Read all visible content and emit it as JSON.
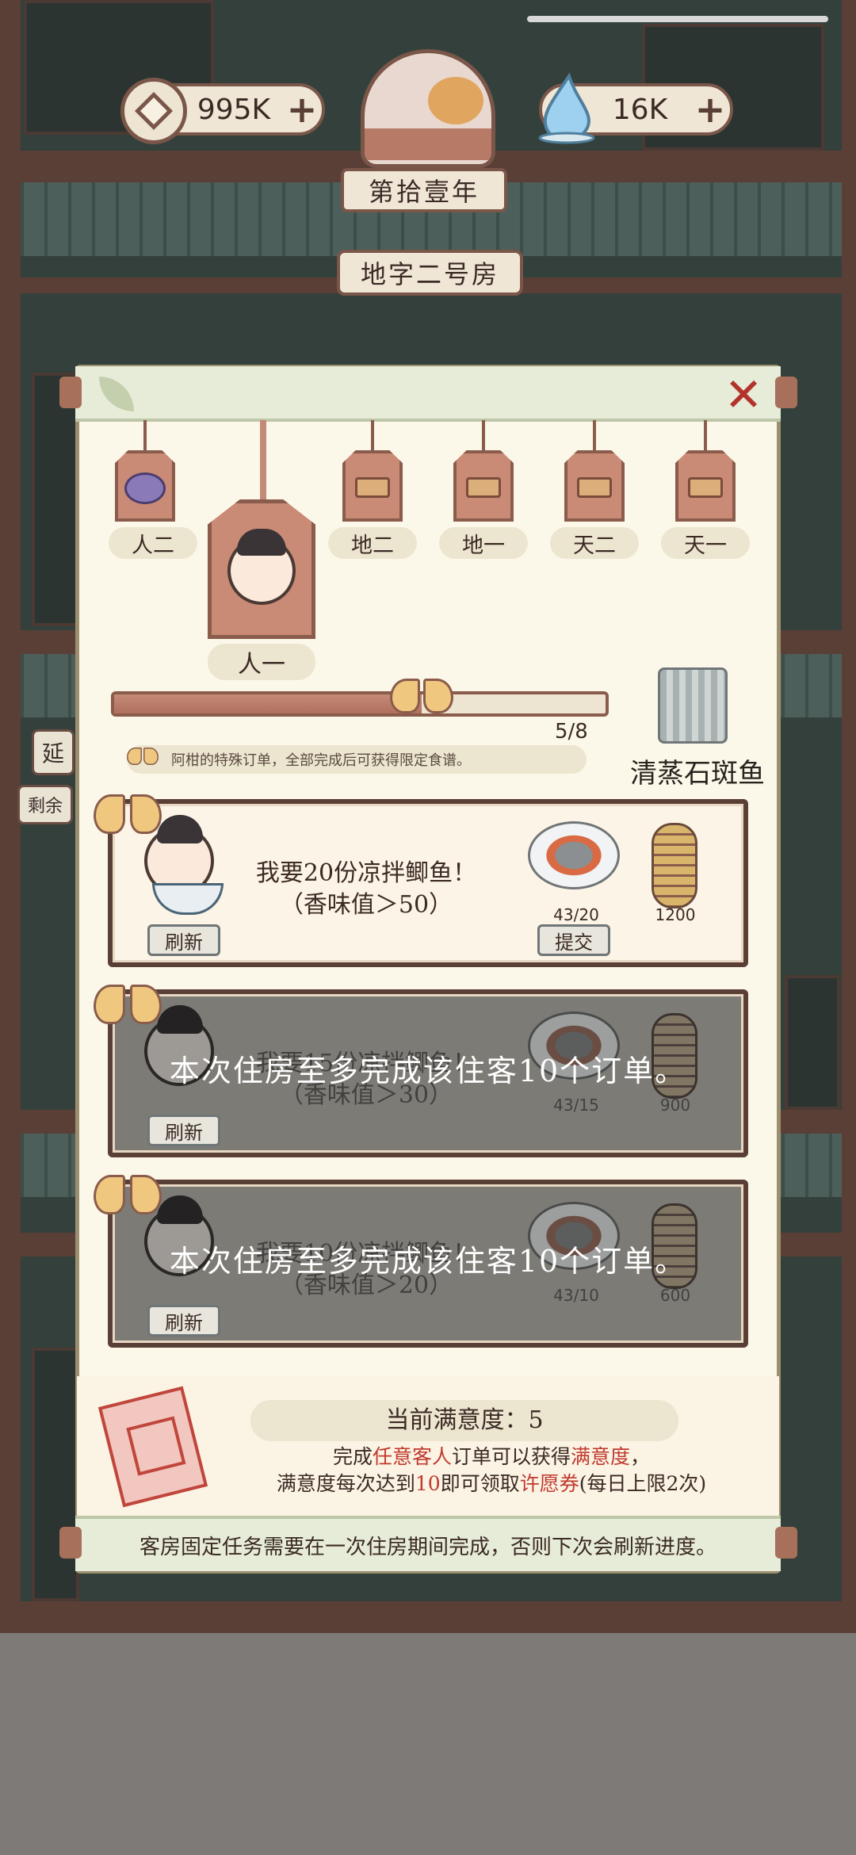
{
  "hud": {
    "coins": "995K",
    "gems": "16K",
    "plus": "+",
    "year": "第拾壹年",
    "room": "地字二号房"
  },
  "scene_labels": [
    "延",
    "剩余"
  ],
  "panel": {
    "close": "✕",
    "tags": [
      {
        "label": "人二"
      },
      {
        "label": "地二"
      },
      {
        "label": "地一"
      },
      {
        "label": "天二"
      },
      {
        "label": "天一"
      }
    ],
    "selected_tag": "人一",
    "progress": {
      "current": 5,
      "total": 8,
      "text": "5/8",
      "fraction": 0.625
    },
    "hint": "阿柑的特殊订单，全部完成后可获得限定食谱。",
    "reward_name": "清蒸石斑鱼"
  },
  "orders": [
    {
      "request_line1": "我要20份凉拌鲫鱼！",
      "request_line2": "（香味值＞50）",
      "dish_count": "43/20",
      "coin_reward": "1200",
      "refresh": "刷新",
      "submit": "提交",
      "locked": false
    },
    {
      "request_line1": "我要15份凉拌鲫鱼！",
      "request_line2": "（香味值＞30）",
      "dish_count": "43/15",
      "coin_reward": "900",
      "refresh": "刷新",
      "locked": true,
      "lock_message": "本次住房至多完成该住客10个订单。"
    },
    {
      "request_line1": "我要10份凉拌鲫鱼！",
      "request_line2": "（香味值＞20）",
      "dish_count": "43/10",
      "coin_reward": "600",
      "refresh": "刷新",
      "locked": true,
      "lock_message": "本次住房至多完成该住客10个订单。"
    }
  ],
  "satisfaction": {
    "title": "当前满意度：5",
    "line1_a": "完成",
    "line1_hl1": "任意客人",
    "line1_b": "订单可以获得",
    "line1_hl2": "满意度",
    "line1_c": "，",
    "line2_a": "满意度每次达到",
    "line2_hl1": "10",
    "line2_b": "即可领取",
    "line2_hl2": "许愿券",
    "line2_c": "(每日上限2次)"
  },
  "footer": "客房固定任务需要在一次住房期间完成，否则下次会刷新进度。"
}
